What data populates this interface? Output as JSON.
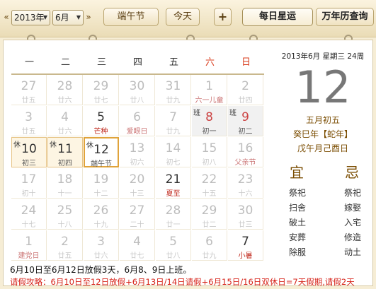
{
  "toolbar": {
    "prev_arrow": "«",
    "next_arrow": "»",
    "year_select": "2013年",
    "month_select": "6月",
    "festival_button": "端午节",
    "today_button": "今天",
    "add_button": "+",
    "horoscope_tab": "每日星运",
    "almanac_tab": "万年历查询"
  },
  "weekdays": [
    "一",
    "二",
    "三",
    "四",
    "五",
    "六",
    "日"
  ],
  "days": [
    {
      "d": "27",
      "l": "廿五",
      "type": "other"
    },
    {
      "d": "28",
      "l": "廿六",
      "type": "other"
    },
    {
      "d": "29",
      "l": "廿七",
      "type": "other"
    },
    {
      "d": "30",
      "l": "廿八",
      "type": "other"
    },
    {
      "d": "31",
      "l": "廿九",
      "type": "other"
    },
    {
      "d": "1",
      "l": "六一儿童",
      "type": "other",
      "fest": true
    },
    {
      "d": "2",
      "l": "廿四",
      "type": "other"
    },
    {
      "d": "3",
      "l": "廿五",
      "type": "other"
    },
    {
      "d": "4",
      "l": "廿六",
      "type": "other"
    },
    {
      "d": "5",
      "l": "芒种",
      "type": "normal",
      "term": true
    },
    {
      "d": "6",
      "l": "爱眼日",
      "type": "other",
      "fest": true
    },
    {
      "d": "7",
      "l": "廿九",
      "type": "other"
    },
    {
      "d": "8",
      "l": "初一",
      "type": "work",
      "badge": "班"
    },
    {
      "d": "9",
      "l": "初二",
      "type": "work",
      "badge": "班"
    },
    {
      "d": "10",
      "l": "初三",
      "type": "rest",
      "badge": "休"
    },
    {
      "d": "11",
      "l": "初四",
      "type": "rest",
      "badge": "休"
    },
    {
      "d": "12",
      "l": "端午节",
      "type": "today",
      "badge": "休"
    },
    {
      "d": "13",
      "l": "初六",
      "type": "other"
    },
    {
      "d": "14",
      "l": "初七",
      "type": "other"
    },
    {
      "d": "15",
      "l": "初八",
      "type": "other"
    },
    {
      "d": "16",
      "l": "父亲节",
      "type": "other",
      "fest": true
    },
    {
      "d": "17",
      "l": "初十",
      "type": "other"
    },
    {
      "d": "18",
      "l": "十一",
      "type": "other"
    },
    {
      "d": "19",
      "l": "十二",
      "type": "other"
    },
    {
      "d": "20",
      "l": "十三",
      "type": "other"
    },
    {
      "d": "21",
      "l": "夏至",
      "type": "normal",
      "term": true
    },
    {
      "d": "22",
      "l": "十五",
      "type": "other"
    },
    {
      "d": "23",
      "l": "十六",
      "type": "other"
    },
    {
      "d": "24",
      "l": "十七",
      "type": "other"
    },
    {
      "d": "25",
      "l": "十八",
      "type": "other"
    },
    {
      "d": "26",
      "l": "十九",
      "type": "other"
    },
    {
      "d": "27",
      "l": "二十",
      "type": "other"
    },
    {
      "d": "28",
      "l": "廿一",
      "type": "other"
    },
    {
      "d": "29",
      "l": "廿二",
      "type": "other"
    },
    {
      "d": "30",
      "l": "廿三",
      "type": "other"
    },
    {
      "d": "1",
      "l": "建党日",
      "type": "other",
      "fest": true
    },
    {
      "d": "2",
      "l": "廿五",
      "type": "other"
    },
    {
      "d": "3",
      "l": "廿六",
      "type": "other"
    },
    {
      "d": "4",
      "l": "廿七",
      "type": "other"
    },
    {
      "d": "5",
      "l": "廿八",
      "type": "other"
    },
    {
      "d": "6",
      "l": "廿九",
      "type": "other"
    },
    {
      "d": "7",
      "l": "小暑",
      "type": "normal",
      "term": true
    }
  ],
  "info": {
    "dateline": "2013年6月 星期三 24周",
    "day": "12",
    "lunar": "五月初五",
    "ganzhi_year": "癸巳年【蛇年】",
    "ganzhi_month_day": "戊午月己酉日",
    "yi_label": "宜",
    "ji_label": "忌",
    "yi": [
      "祭祀",
      "扫舍",
      "破土",
      "安葬",
      "除服"
    ],
    "ji": [
      "祭祀",
      "嫁娶",
      "入宅",
      "修造",
      "动土"
    ]
  },
  "notes": {
    "line1": "6月10日至6月12日放假3天，6月8、9日上班。",
    "line2": "请假攻略：6月10日至12日放假+6月13日/14日请假+6月15日/16日双休日=7天假期,请假2天"
  },
  "colors": {
    "background": "#f6edd5",
    "weekend_red": "#d83a1a",
    "accent_gold": "#e0a33a",
    "note_red": "#d62218",
    "almanac_brown": "#7a4c00"
  }
}
